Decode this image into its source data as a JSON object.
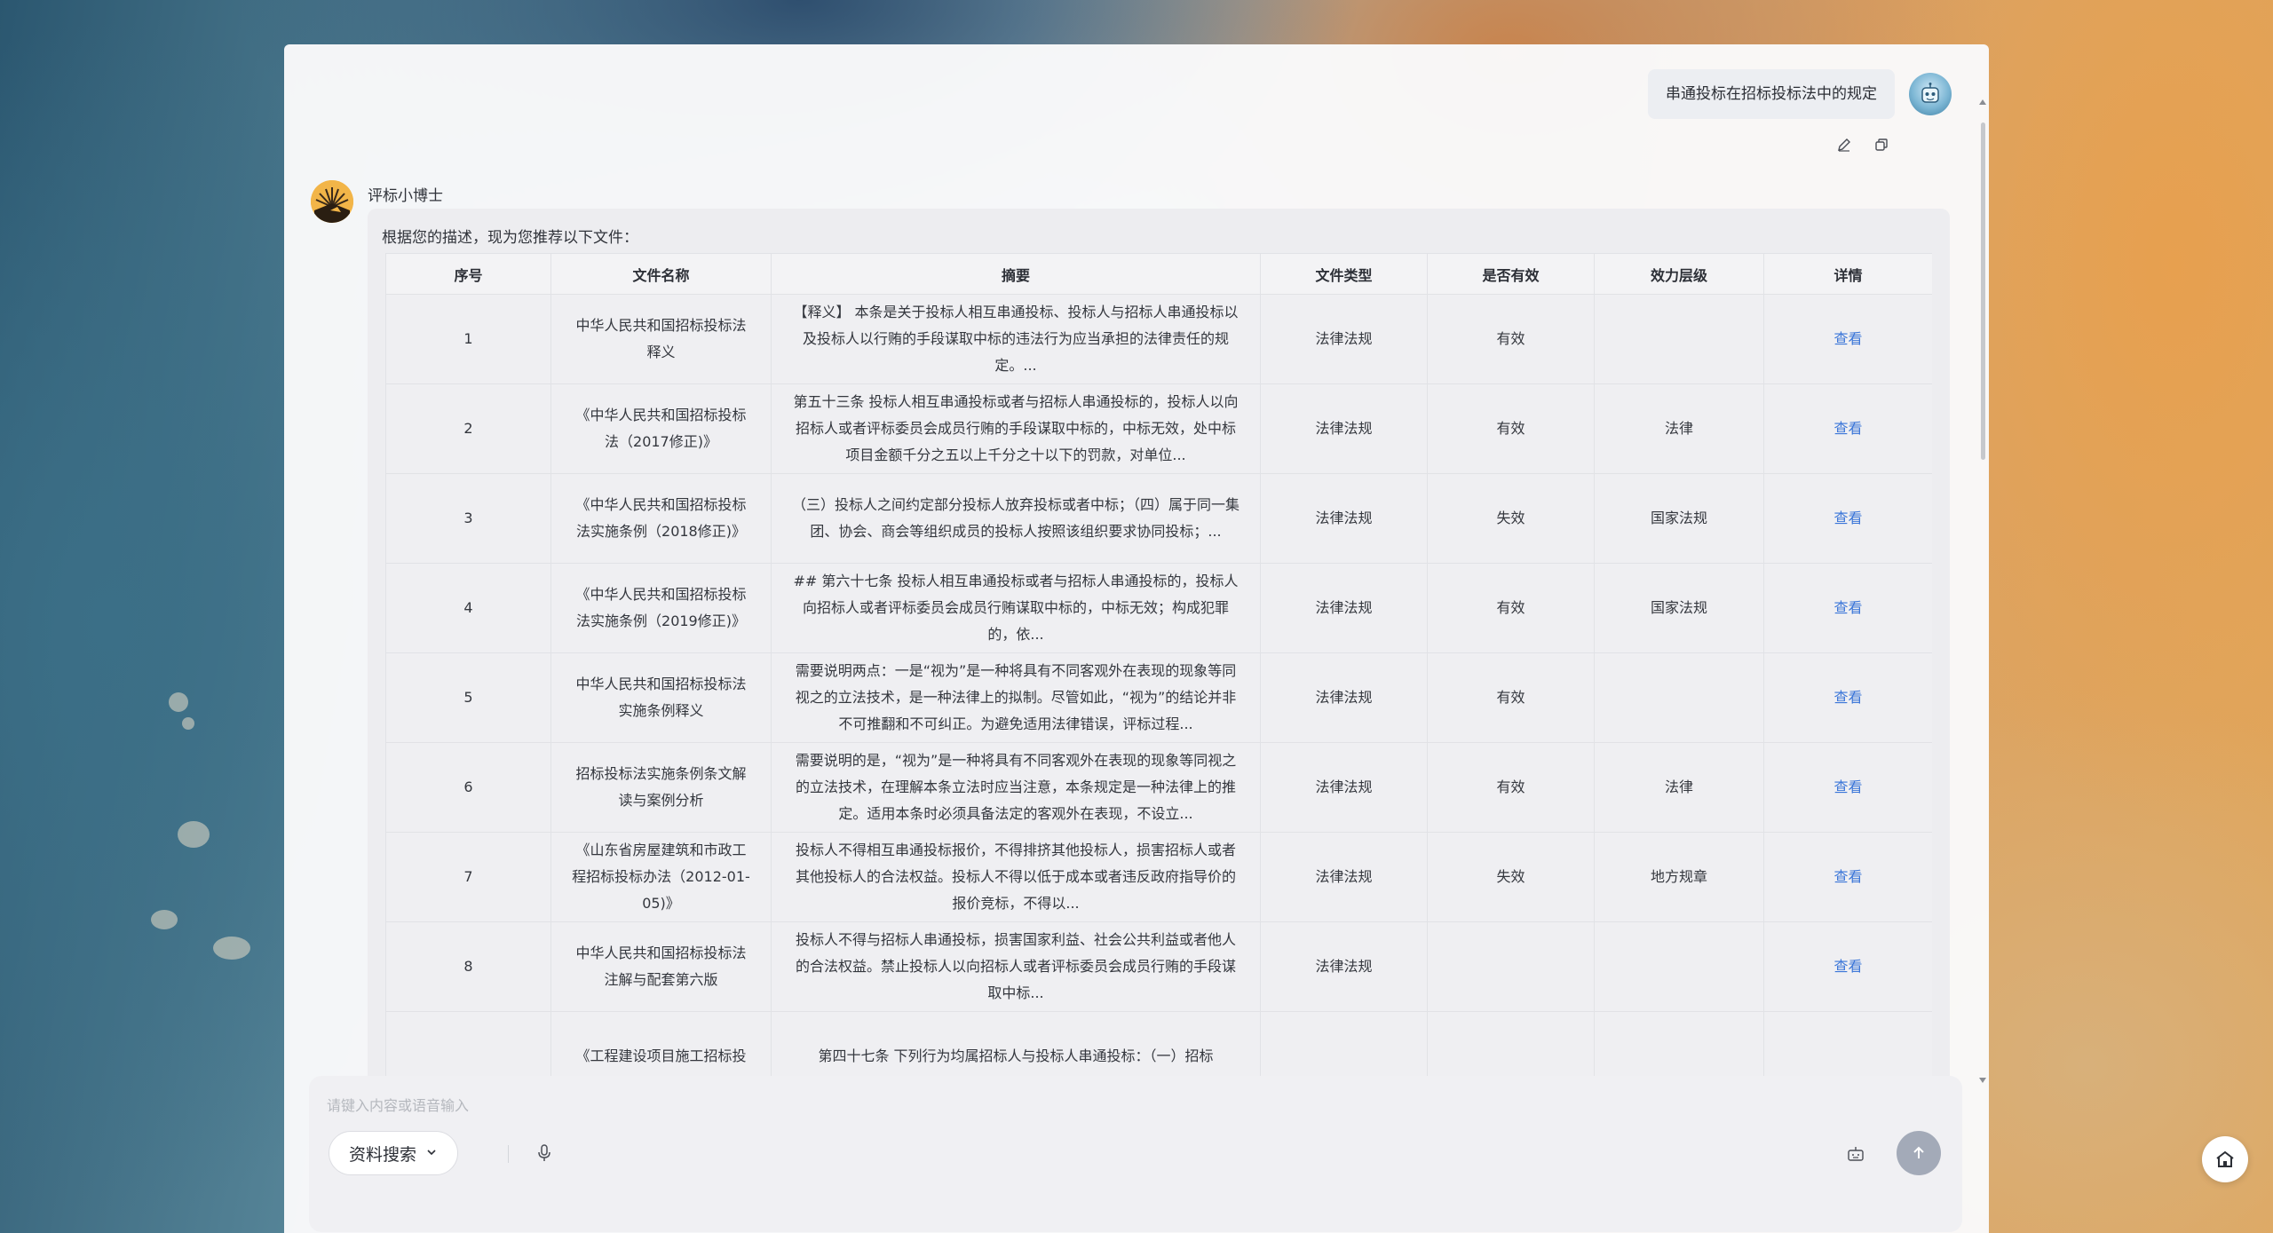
{
  "user_message": {
    "text": "串通投标在招标投标法中的规定"
  },
  "bot": {
    "name": "评标小博士",
    "intro": "根据您的描述，现为您推荐以下文件："
  },
  "table": {
    "headers": [
      "序号",
      "文件名称",
      "摘要",
      "文件类型",
      "是否有效",
      "效力层级",
      "详情"
    ],
    "rows": [
      {
        "no": "1",
        "name": "中华人民共和国招标投标法释义",
        "summary": "【释义】 本条是关于投标人相互串通投标、投标人与招标人串通投标以及投标人以行贿的手段谋取中标的违法行为应当承担的法律责任的规定。...",
        "type": "法律法规",
        "valid": "有效",
        "level": "",
        "detail": "查看"
      },
      {
        "no": "2",
        "name": "《中华人民共和国招标投标法（2017修正)》",
        "summary": "第五十三条 投标人相互串通投标或者与招标人串通投标的，投标人以向招标人或者评标委员会成员行贿的手段谋取中标的，中标无效，处中标项目金额千分之五以上千分之十以下的罚款，对单位...",
        "type": "法律法规",
        "valid": "有效",
        "level": "法律",
        "detail": "查看"
      },
      {
        "no": "3",
        "name": "《中华人民共和国招标投标法实施条例（2018修正)》",
        "summary": "（三）投标人之间约定部分投标人放弃投标或者中标；（四）属于同一集团、协会、商会等组织成员的投标人按照该组织要求协同投标；...",
        "type": "法律法规",
        "valid": "失效",
        "level": "国家法规",
        "detail": "查看"
      },
      {
        "no": "4",
        "name": "《中华人民共和国招标投标法实施条例（2019修正)》",
        "summary": "## 第六十七条 投标人相互串通投标或者与招标人串通投标的，投标人向招标人或者评标委员会成员行贿谋取中标的，中标无效；构成犯罪的，依...",
        "type": "法律法规",
        "valid": "有效",
        "level": "国家法规",
        "detail": "查看"
      },
      {
        "no": "5",
        "name": "中华人民共和国招标投标法实施条例释义",
        "summary": "需要说明两点：一是“视为”是一种将具有不同客观外在表现的现象等同视之的立法技术，是一种法律上的拟制。尽管如此，“视为”的结论并非不可推翻和不可纠正。为避免适用法律错误，评标过程...",
        "type": "法律法规",
        "valid": "有效",
        "level": "",
        "detail": "查看"
      },
      {
        "no": "6",
        "name": "招标投标法实施条例条文解读与案例分析",
        "summary": "需要说明的是，“视为”是一种将具有不同客观外在表现的现象等同视之的立法技术，在理解本条立法时应当注意，本条规定是一种法律上的推定。适用本条时必须具备法定的客观外在表现，不设立...",
        "type": "法律法规",
        "valid": "有效",
        "level": "法律",
        "detail": "查看"
      },
      {
        "no": "7",
        "name": "《山东省房屋建筑和市政工程招标投标办法（2012-01-05)》",
        "summary": "投标人不得相互串通投标报价，不得排挤其他投标人，损害招标人或者其他投标人的合法权益。投标人不得以低于成本或者违反政府指导价的报价竞标，不得以...",
        "type": "法律法规",
        "valid": "失效",
        "level": "地方规章",
        "detail": "查看"
      },
      {
        "no": "8",
        "name": "中华人民共和国招标投标法注解与配套第六版",
        "summary": "投标人不得与招标人串通投标，损害国家利益、社会公共利益或者他人的合法权益。禁止投标人以向招标人或者评标委员会成员行贿的手段谋取中标...",
        "type": "法律法规",
        "valid": "",
        "level": "",
        "detail": "查看"
      },
      {
        "no": "",
        "name": "《工程建设项目施工招标投",
        "summary": "第四十七条 下列行为均属招标人与投标人串通投标：（一）招标",
        "type": "",
        "valid": "",
        "level": "",
        "detail": ""
      }
    ]
  },
  "input": {
    "placeholder": "请键入内容或语音输入",
    "mode_label": "资料搜索"
  },
  "icons": {
    "edit": "edit-icon",
    "copy": "copy-icon",
    "mic": "microphone-icon",
    "keyboard": "keyboard-icon",
    "send": "arrow-up-icon",
    "home": "home-icon",
    "dropdown": "chevron-down-icon"
  },
  "colors": {
    "link": "#3a75d8",
    "send_button": "#a3aab8"
  }
}
